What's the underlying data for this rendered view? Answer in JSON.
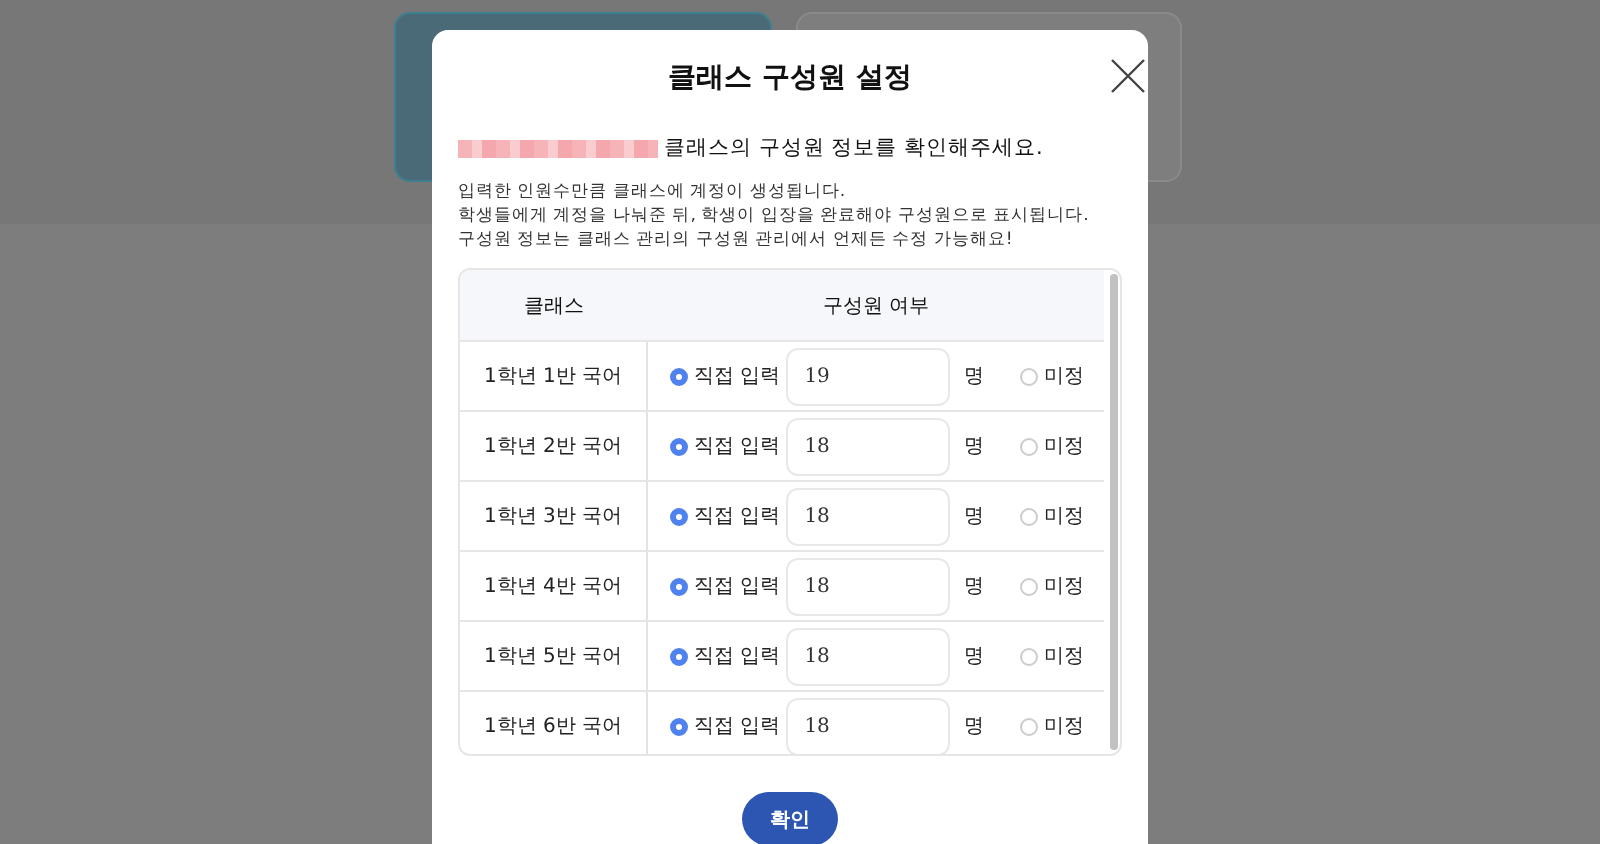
{
  "dialog": {
    "title": "클래스 구성원 설정",
    "intro": "클래스의 구성원 정보를 확인해주세요.",
    "notes": [
      "입력한 인원수만큼 클래스에 계정이 생성됩니다.",
      "학생들에게 계정을 나눠준 뒤, 학생이 입장을 완료해야 구성원으로 표시됩니다.",
      "구성원 정보는 클래스 관리의 구성원 관리에서 언제든 수정 가능해요!"
    ],
    "table": {
      "columns": [
        "클래스",
        "구성원 여부"
      ],
      "rows": [
        {
          "class": "1학년 1반 국어",
          "direct": {
            "label": "직접 입력",
            "selected": true
          },
          "count": "19",
          "unit": "명",
          "undecided": {
            "label": "미정",
            "selected": false
          }
        },
        {
          "class": "1학년 2반 국어",
          "direct": {
            "label": "직접 입력",
            "selected": true
          },
          "count": "18",
          "unit": "명",
          "undecided": {
            "label": "미정",
            "selected": false
          }
        },
        {
          "class": "1학년 3반 국어",
          "direct": {
            "label": "직접 입력",
            "selected": true
          },
          "count": "18",
          "unit": "명",
          "undecided": {
            "label": "미정",
            "selected": false
          }
        },
        {
          "class": "1학년 4반 국어",
          "direct": {
            "label": "직접 입력",
            "selected": true
          },
          "count": "18",
          "unit": "명",
          "undecided": {
            "label": "미정",
            "selected": false
          }
        },
        {
          "class": "1학년 5반 국어",
          "direct": {
            "label": "직접 입력",
            "selected": true
          },
          "count": "18",
          "unit": "명",
          "undecided": {
            "label": "미정",
            "selected": false
          }
        },
        {
          "class": "1학년 6반 국어",
          "direct": {
            "label": "직접 입력",
            "selected": true
          },
          "count": "18",
          "unit": "명",
          "undecided": {
            "label": "미정",
            "selected": false
          }
        }
      ]
    },
    "confirm_button": "확인"
  }
}
